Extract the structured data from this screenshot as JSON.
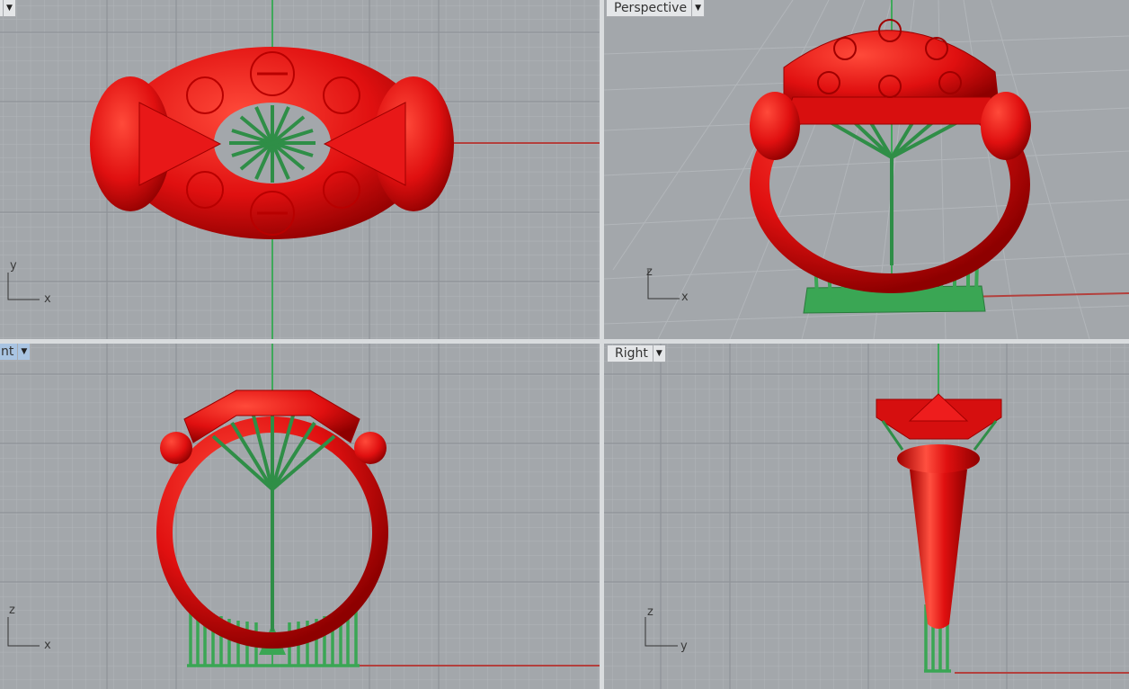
{
  "viewports": {
    "top": {
      "label": "",
      "axis_h": "x",
      "axis_v": "y"
    },
    "perspective": {
      "label": "Perspective",
      "axis_h": "x",
      "axis_v": "z"
    },
    "front": {
      "label": "nt",
      "axis_h": "x",
      "axis_v": "z"
    },
    "right": {
      "label": "Right",
      "axis_h": "y",
      "axis_v": "z"
    }
  },
  "icons": {
    "dropdown": "dropdown-arrow-icon"
  },
  "colors": {
    "model": "#e01010",
    "model_shadow": "#9a0000",
    "supports": "#3aa654",
    "axis_x": "#b3403d",
    "axis_y": "#3fa85a",
    "grid_bg": "#a3a7ab",
    "grid_line": "#b4b8bc",
    "grid_major": "#8d9196"
  }
}
